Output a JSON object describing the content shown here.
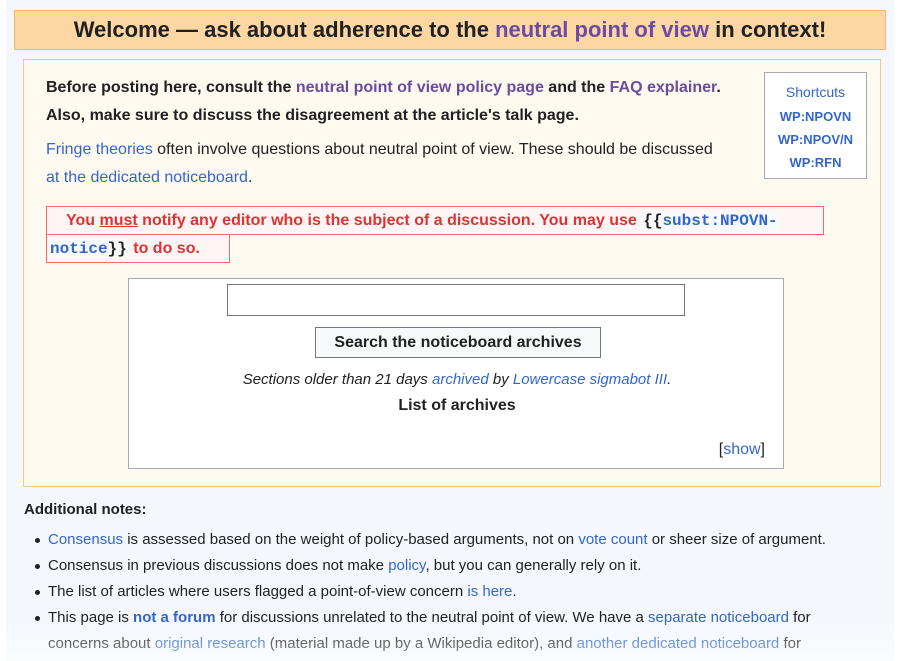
{
  "banner": {
    "prefix": "Welcome — ask about adherence to the ",
    "link": "neutral point of view",
    "suffix": " in context!"
  },
  "intro": {
    "t1": "Before posting here, consult the ",
    "link_policy": "neutral point of view policy page",
    "t2": " and the ",
    "link_faq": "FAQ explainer",
    "t3": ". Also, make sure to discuss the disagreement at the article's talk page."
  },
  "fringe": {
    "link_fringe": "Fringe theories",
    "t1": " often involve questions about neutral point of view. These should be discussed ",
    "link_board": "at the dedicated noticeboard",
    "t2": "."
  },
  "shortcuts": {
    "title": "Shortcuts",
    "items": [
      "WP:NPOVN",
      "WP:NPOV/N",
      "WP:RFN"
    ]
  },
  "warning": {
    "t1": "You ",
    "must": "must",
    "t2": " notify any editor who is the subject of a discussion. You may use ",
    "code_open": "{{",
    "code_tmpl1": "subst:NPOVN-",
    "code_tmpl2": "notice",
    "code_close": "}}",
    "t3": " to do so."
  },
  "archive": {
    "search_value": "",
    "search_button": "Search the noticeboard archives",
    "note_t1": "Sections older than 21 days ",
    "note_link_archived": "archived",
    "note_t2": " by ",
    "note_link_bot": "Lowercase sigmabot III",
    "note_t3": ".",
    "list_title": "List of archives",
    "show_open": "[",
    "show_link": "show",
    "show_close": "]"
  },
  "notes": {
    "title": "Additional notes:",
    "n1": {
      "link_consensus": "Consensus",
      "t1": " is assessed based on the weight of policy-based arguments, not on ",
      "link_vote": "vote count",
      "t2": " or sheer size of argument."
    },
    "n2": {
      "t1": "Consensus in previous discussions does not make ",
      "link_policy": "policy",
      "t2": ", but you can generally rely on it."
    },
    "n3": {
      "t1": "The list of articles where users flagged a point-of-view concern ",
      "link_here": "is here",
      "t2": "."
    },
    "n4": {
      "t1": "This page is ",
      "link_forum": "not a forum",
      "t2": " for discussions unrelated to the neutral point of view. We have a ",
      "link_separate": "separate noticeboard",
      "t3": " for concerns about ",
      "link_or": "original research",
      "t4": " (material made up by a Wikipedia editor), and ",
      "link_another": "another dedicated noticeboard",
      "t5": " for"
    }
  }
}
